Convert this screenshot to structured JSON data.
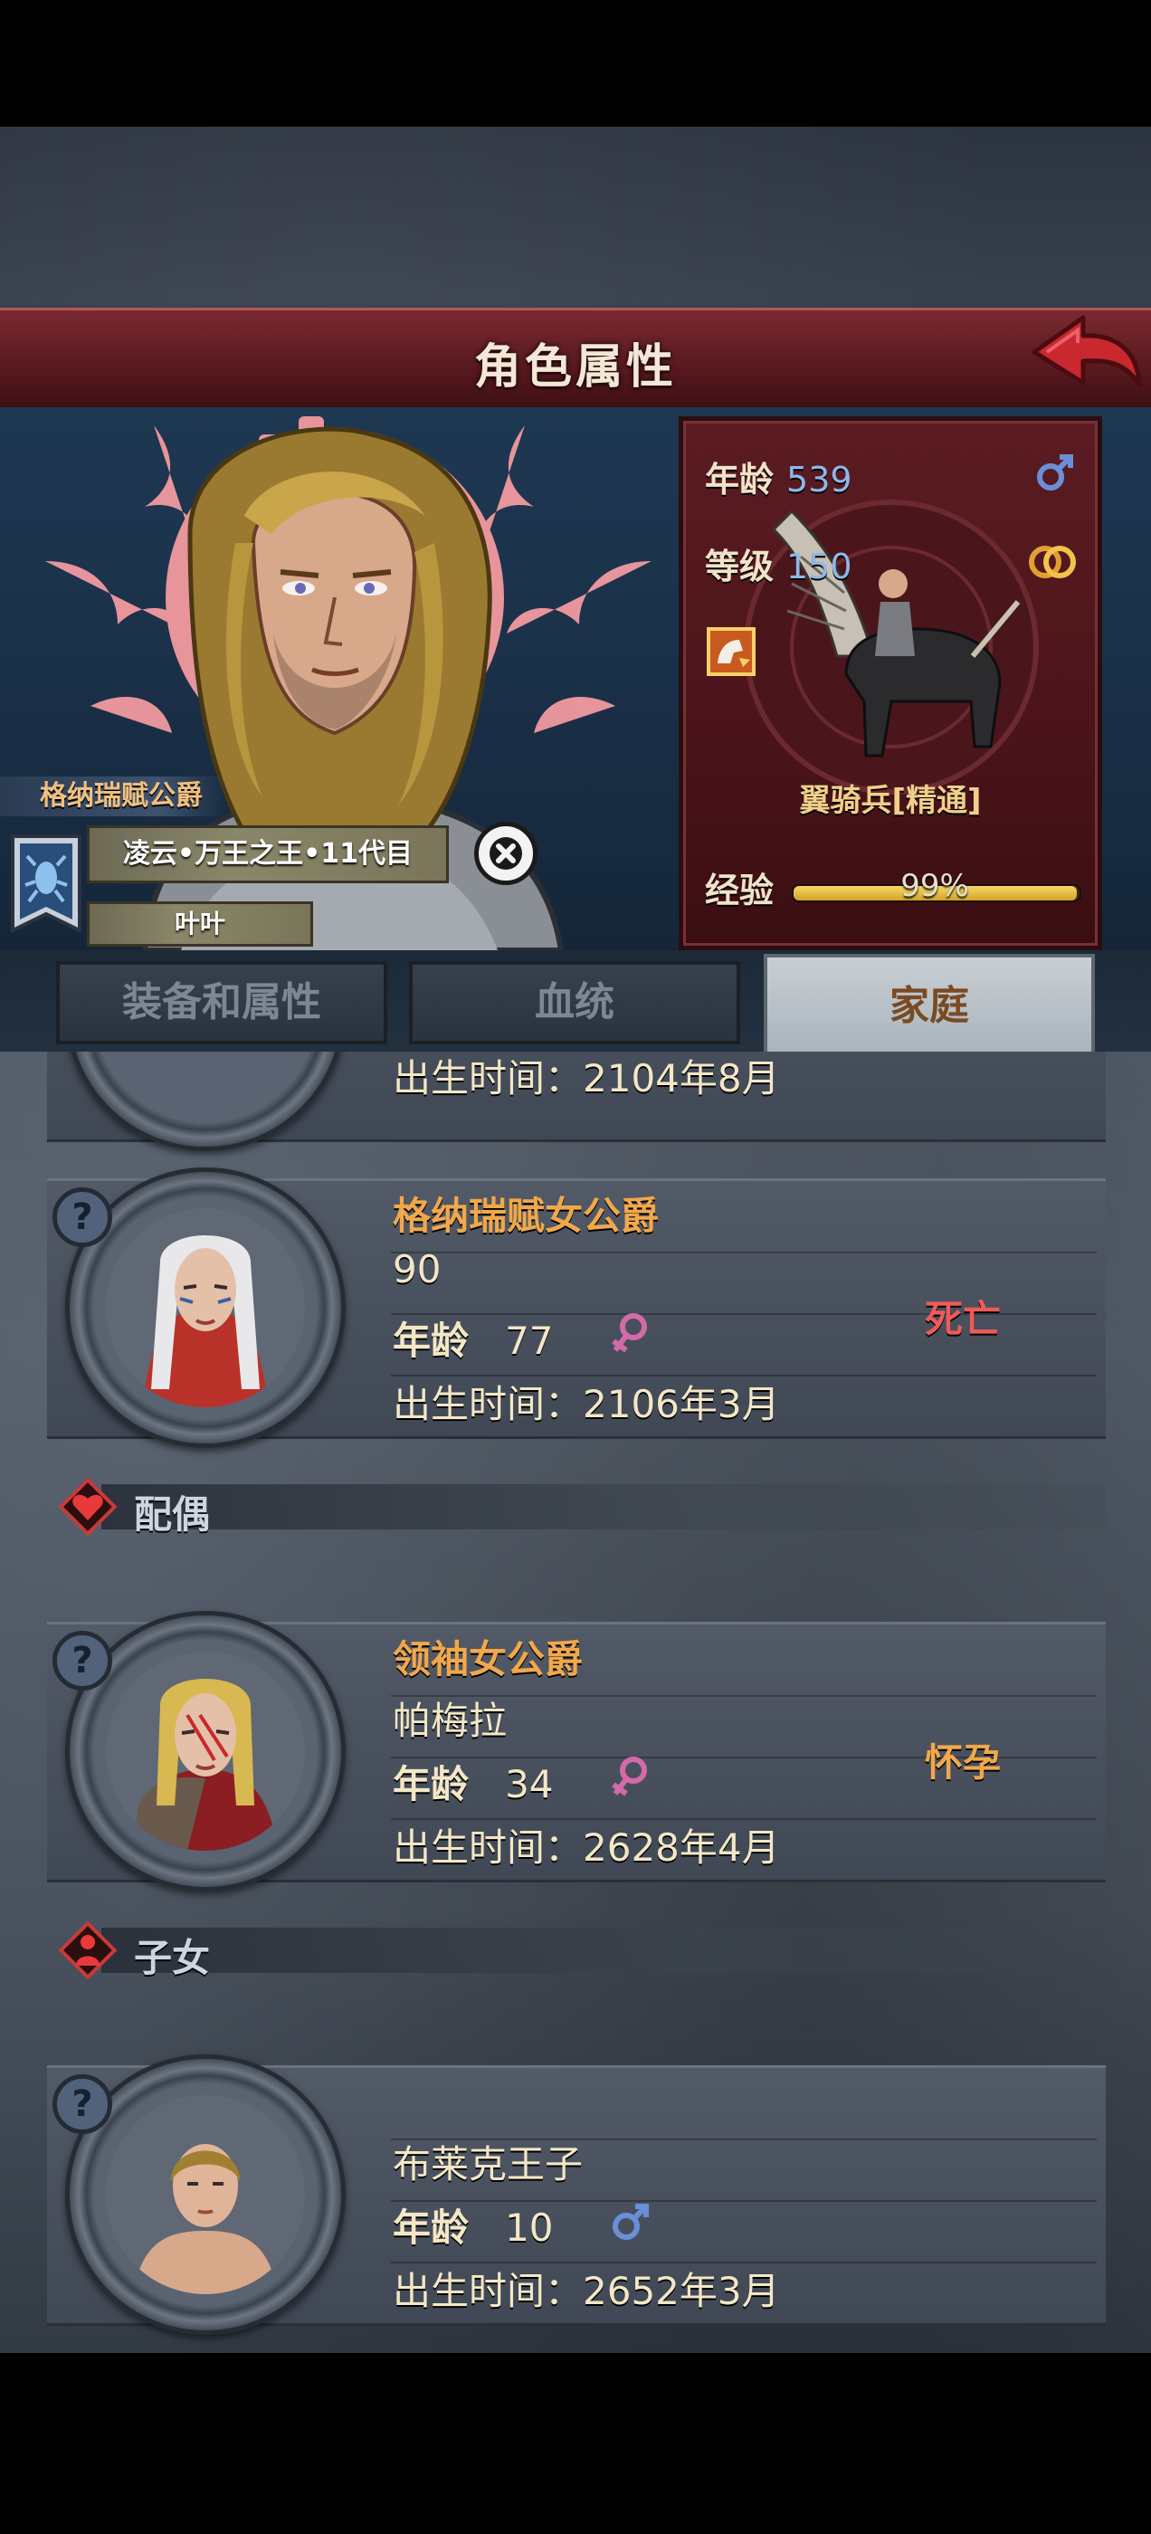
{
  "header": {
    "title": "角色属性"
  },
  "character": {
    "rank_title": "格纳瑞赋公爵",
    "lineage": "凌云•万王之王•11代目",
    "name": "叶叶"
  },
  "stats": {
    "age_label": "年龄",
    "age_value": "539",
    "level_label": "等级",
    "level_value": "150",
    "unit_name": "翼骑兵[精通]",
    "exp_label": "经验",
    "exp_text": "99%",
    "exp_fraction": 0.99
  },
  "tabs": [
    {
      "label": "装备和属性",
      "active": false
    },
    {
      "label": "血统",
      "active": false
    },
    {
      "label": "家庭",
      "active": true
    }
  ],
  "partial_card": {
    "birth": "出生时间：2104年8月"
  },
  "parents": [
    {
      "title": "格纳瑞赋女公爵",
      "name": "90",
      "age_label": "年龄",
      "age": "77",
      "gender": "female",
      "birth": "出生时间：2106年3月",
      "status": "死亡",
      "status_color": "#ef5a5a"
    }
  ],
  "sections": {
    "spouse_label": "配偶",
    "children_label": "子女"
  },
  "spouse": {
    "title": "领袖女公爵",
    "name": "帕梅拉",
    "age_label": "年龄",
    "age": "34",
    "gender": "female",
    "birth": "出生时间：2628年4月",
    "status": "怀孕",
    "status_color": "#f0a84c"
  },
  "child": {
    "name": "布莱克王子",
    "age_label": "年龄",
    "age": "10",
    "gender": "male",
    "birth": "出生时间：2652年3月"
  },
  "colors": {
    "accent_orange": "#f0a84c",
    "female": "#d46aa8",
    "male": "#6a8fd8",
    "title_red": "#6a1e24"
  },
  "icons": {
    "back": "red-back-arrow-icon",
    "close": "close-circle-icon",
    "male": "male-symbol-icon",
    "female": "female-symbol-icon",
    "rings": "wedding-rings-icon",
    "question": "question-mark-icon",
    "heart": "heart-icon",
    "child": "child-icon"
  }
}
